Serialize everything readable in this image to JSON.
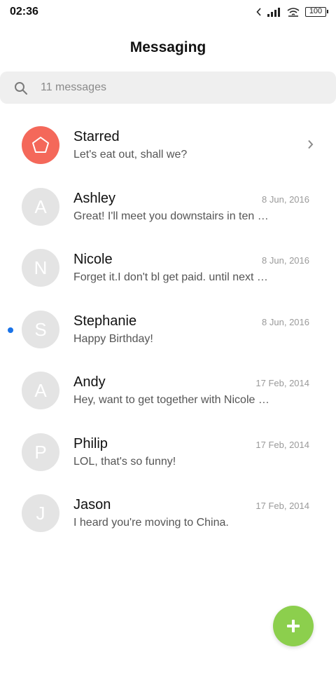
{
  "status_bar": {
    "time": "02:36",
    "battery": "100"
  },
  "header": {
    "title": "Messaging"
  },
  "search": {
    "placeholder": "11 messages"
  },
  "conversations": [
    {
      "name": "Starred",
      "preview": "Let's eat out, shall we?",
      "date": "",
      "avatar_letter": "",
      "starred": true,
      "unread": false
    },
    {
      "name": "Ashley",
      "preview": "Great! I'll meet you downstairs in ten …",
      "date": "8 Jun, 2016",
      "avatar_letter": "A",
      "starred": false,
      "unread": false
    },
    {
      "name": "Nicole",
      "preview": "Forget it.I don't bl get paid. until next F…",
      "date": "8 Jun, 2016",
      "avatar_letter": "N",
      "starred": false,
      "unread": false
    },
    {
      "name": "Stephanie",
      "preview": "Happy Birthday!",
      "date": "8 Jun, 2016",
      "avatar_letter": "S",
      "starred": false,
      "unread": true
    },
    {
      "name": "Andy",
      "preview": "Hey, want to get together with Nicole …",
      "date": "17 Feb, 2014",
      "avatar_letter": "A",
      "starred": false,
      "unread": false
    },
    {
      "name": "Philip",
      "preview": "LOL, that's so funny!",
      "date": "17 Feb, 2014",
      "avatar_letter": "P",
      "starred": false,
      "unread": false
    },
    {
      "name": "Jason",
      "preview": "I heard you're moving to China.",
      "date": "17 Feb, 2014",
      "avatar_letter": "J",
      "starred": false,
      "unread": false
    }
  ],
  "colors": {
    "starred_avatar": "#f4685a",
    "avatar_default": "#e4e4e4",
    "unread_dot": "#1a73e8",
    "fab": "#8ccf4d",
    "search_bg": "#efefef"
  },
  "icons": {
    "starred": "pentagon-star-icon",
    "fab": "plus-icon",
    "search": "search-icon",
    "chevron": "chevron-right-icon"
  }
}
